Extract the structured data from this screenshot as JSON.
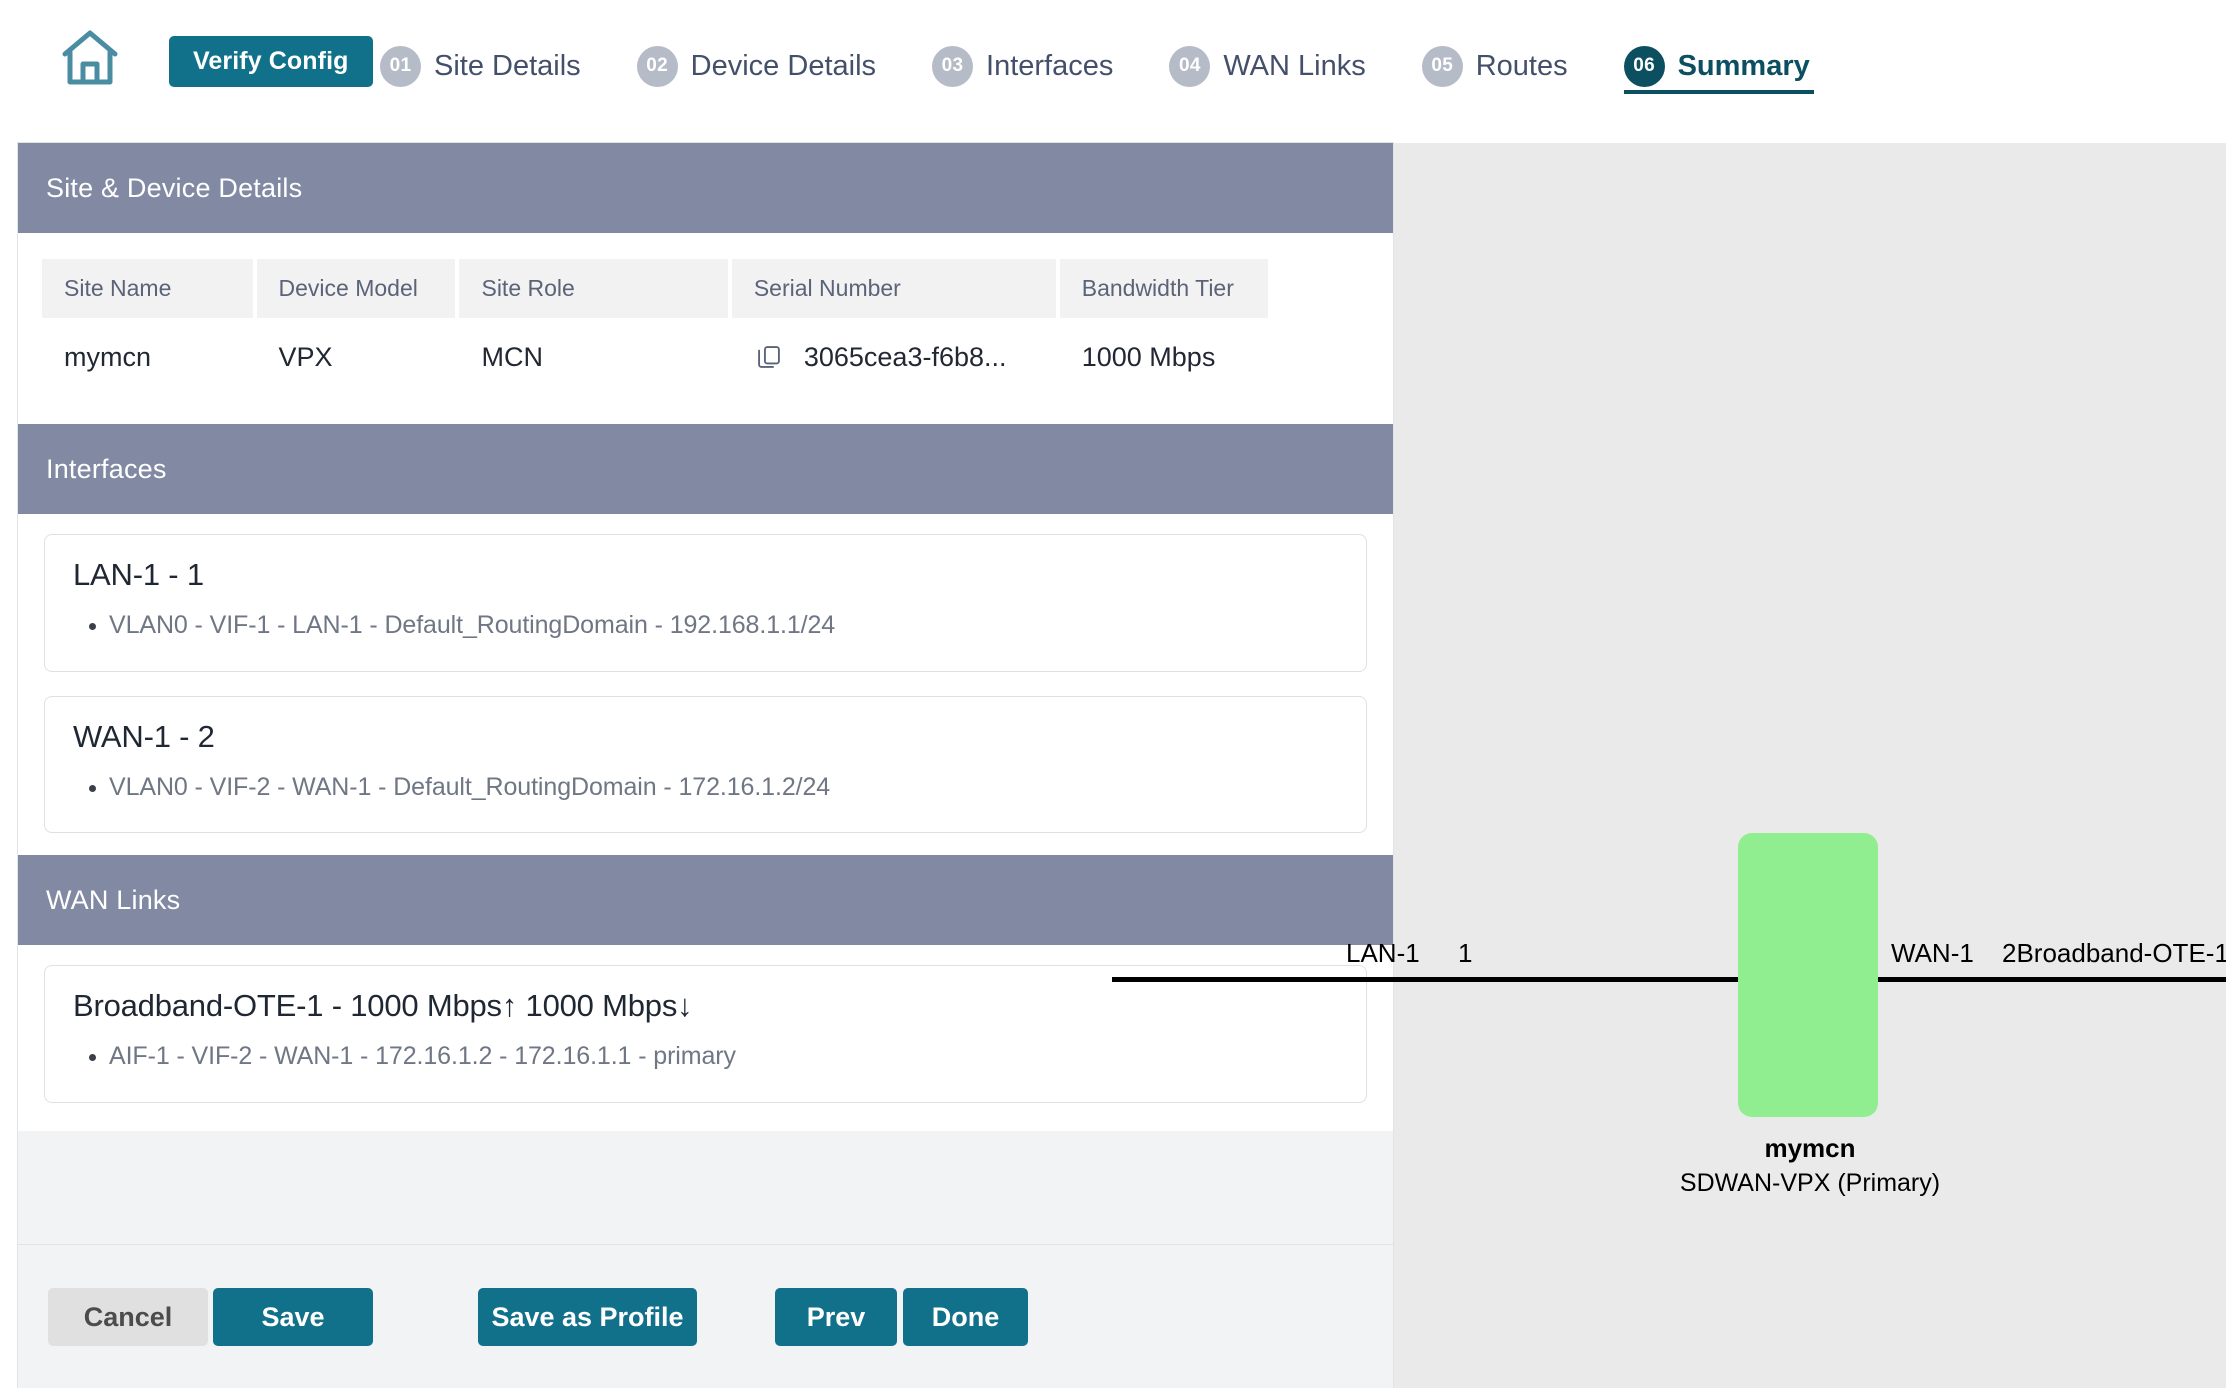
{
  "header": {
    "home_icon": "home-icon",
    "verify_button": "Verify Config",
    "steps": [
      {
        "num": "01",
        "label": "Site Details",
        "active": false
      },
      {
        "num": "02",
        "label": "Device Details",
        "active": false
      },
      {
        "num": "03",
        "label": "Interfaces",
        "active": false
      },
      {
        "num": "04",
        "label": "WAN Links",
        "active": false
      },
      {
        "num": "05",
        "label": "Routes",
        "active": false
      },
      {
        "num": "06",
        "label": "Summary",
        "active": true
      }
    ]
  },
  "sections": {
    "site_device": {
      "title": "Site & Device Details",
      "columns": [
        "Site Name",
        "Device Model",
        "Site Role",
        "Serial Number",
        "Bandwidth Tier"
      ],
      "row": {
        "site_name": "mymcn",
        "device_model": "VPX",
        "site_role": "MCN",
        "serial_number": "3065cea3-f6b8...",
        "copy_icon": "copy-icon",
        "bandwidth_tier": "1000 Mbps"
      }
    },
    "interfaces": {
      "title": "Interfaces",
      "items": [
        {
          "name": "LAN-1 - 1",
          "details": [
            "VLAN0 - VIF-1 - LAN-1 - Default_RoutingDomain - 192.168.1.1/24"
          ]
        },
        {
          "name": "WAN-1 - 2",
          "details": [
            "VLAN0 - VIF-2 - WAN-1 - Default_RoutingDomain - 172.16.1.2/24"
          ]
        }
      ]
    },
    "wan_links": {
      "title": "WAN Links",
      "items": [
        {
          "name": "Broadband-OTE-1 - 1000 Mbps↑ 1000 Mbps↓",
          "details": [
            "AIF-1 - VIF-2 - WAN-1 - 172.16.1.2 - 172.16.1.1 - primary"
          ]
        }
      ]
    }
  },
  "footer": {
    "cancel": "Cancel",
    "save": "Save",
    "save_as_profile": "Save as Profile",
    "prev": "Prev",
    "done": "Done"
  },
  "diagram": {
    "node_color": "#90ee90",
    "node_name": "mymcn",
    "node_subtitle": "SDWAN-VPX (Primary)",
    "left_link": {
      "name": "LAN-1",
      "number": "1"
    },
    "right_link": {
      "name": "WAN-1",
      "number": "2Broadband-OTE-1"
    }
  },
  "colors": {
    "accent_teal": "#11708a",
    "active_step": "#0c4f60",
    "section_bar": "#828aa3",
    "node_green": "#90ee90"
  }
}
